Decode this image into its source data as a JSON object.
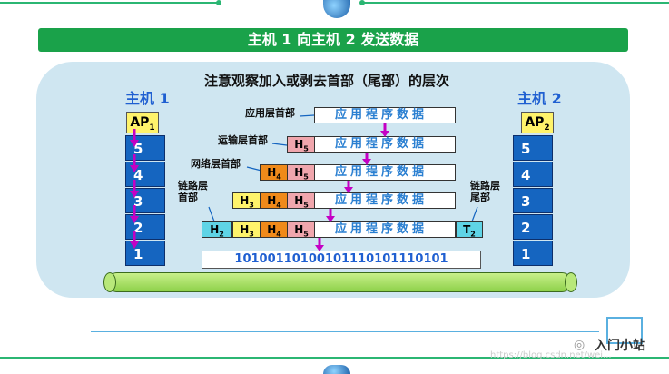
{
  "title": "主机 1 向主机 2 发送数据",
  "heading": "注意观察加入或剥去首部（尾部）的层次",
  "host1": "主机 1",
  "host2": "主机 2",
  "ap_main": "AP",
  "ap1_sub": "1",
  "ap2_sub": "2",
  "layers": [
    "5",
    "4",
    "3",
    "2",
    "1"
  ],
  "labels": {
    "app_header": "应用层首部",
    "transport_header": "运输层首部",
    "network_header": "网络层首部",
    "link_header": "链路层首部",
    "link_trailer": "链路层尾部"
  },
  "app_data": "应用程序数据",
  "h5": "H",
  "h5s": "5",
  "h4": "H",
  "h4s": "4",
  "h3": "H",
  "h3s": "3",
  "h2": "H",
  "h2s": "2",
  "t2": "T",
  "t2s": "2",
  "bits": "10100110100101110101110101",
  "watermark_url": "https://blog.csdn.net/wei...",
  "watermark_brand": "入门小站",
  "colors": {
    "green_bar": "#1aa24a",
    "panel": "#cfe6f1",
    "layer_blue": "#1565c0",
    "ap_yellow": "#fff36b",
    "h5_pink": "#f0a6ad",
    "h4_orange": "#f08a1a",
    "h3_yellow": "#fff36b",
    "h2_cyan": "#5fd4e6",
    "arrow_magenta": "#c400c4"
  }
}
